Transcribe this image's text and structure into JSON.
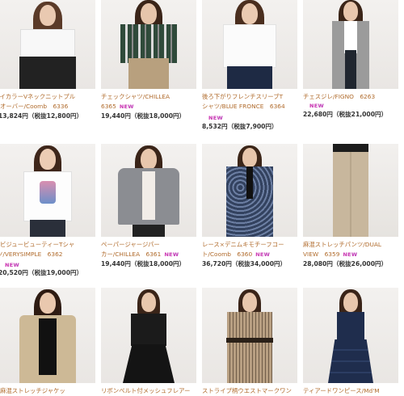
{
  "products": [
    {
      "name": "バイカラーVネックニットプルオーバー/Coomb　6336",
      "line1": "バイカラーVネックニットプル",
      "line2": "オーバー/Coomb　6336",
      "new": false,
      "price": "13,824円",
      "tax": "（税抜12,800円）"
    },
    {
      "name": "チェックシャツ/CHILLEA 6365",
      "line1": "チェックシャツ/CHILLEA",
      "line2": "6365",
      "new": true,
      "price": "19,440円",
      "tax": "（税抜18,000円）"
    },
    {
      "name": "後ろ下がりフレンチスリーブTシャツ/BLUE FRONCE　6364",
      "line1": "後ろ下がりフレンチスリーブT",
      "line2": "シャツ/BLUE FRONCE　6364",
      "new": true,
      "price": "8,532円",
      "tax": "（税抜7,900円）"
    },
    {
      "name": "チェスジレ/FIGNO　6263",
      "line1": "チェスジレ/FIGNO　6263",
      "line2": "",
      "new": true,
      "price": "22,680円",
      "tax": "（税抜21,000円）"
    },
    {
      "name": "ビジュービューティーTシャツ/VERYSIMPLE　6362",
      "line1": "ビジュービューティーTシャ",
      "line2": "ツ/VERYSIMPLE　6362",
      "new": true,
      "price": "20,520円",
      "tax": "（税抜19,000円）"
    },
    {
      "name": "ペーパージャージパーカー/CHILLEA　6361",
      "line1": "ペーパージャージパー",
      "line2": "カー/CHILLEA　6361",
      "new": true,
      "price": "19,440円",
      "tax": "（税抜18,000円）"
    },
    {
      "name": "レース×デニムキモチーフコート/Coomb　6360",
      "line1": "レース×デニムキモチーフコー",
      "line2": "ト/Coomb　6360",
      "new": true,
      "price": "36,720円",
      "tax": "（税抜34,000円）"
    },
    {
      "name": "麻混ストレッチパンツ/DUAL VIEW　6359",
      "line1": "麻混ストレッチパンツ/DUAL",
      "line2": "VIEW　6359",
      "new": true,
      "price": "28,080円",
      "tax": "（税抜26,000円）"
    },
    {
      "name": "麻混ストレッチジャケッ",
      "line1": "麻混ストレッチジャケッ",
      "line2": "",
      "new": false,
      "price": "",
      "tax": ""
    },
    {
      "name": "リボンベルト付メッシュフレアー",
      "line1": "リボンベルト付メッシュフレアー",
      "line2": "",
      "new": false,
      "price": "",
      "tax": ""
    },
    {
      "name": "ストライプ柄ウエストマークワン",
      "line1": "ストライプ柄ウエストマークワン",
      "line2": "",
      "new": false,
      "price": "",
      "tax": ""
    },
    {
      "name": "ティアードワンピース/Md'M",
      "line1": "ティアードワンピース/Md'M",
      "line2": "",
      "new": false,
      "price": "",
      "tax": ""
    }
  ],
  "badge_text": "NEW",
  "colors": {
    "link": "#b06b2c",
    "price": "#333333",
    "new_badge": "#d045b8"
  }
}
